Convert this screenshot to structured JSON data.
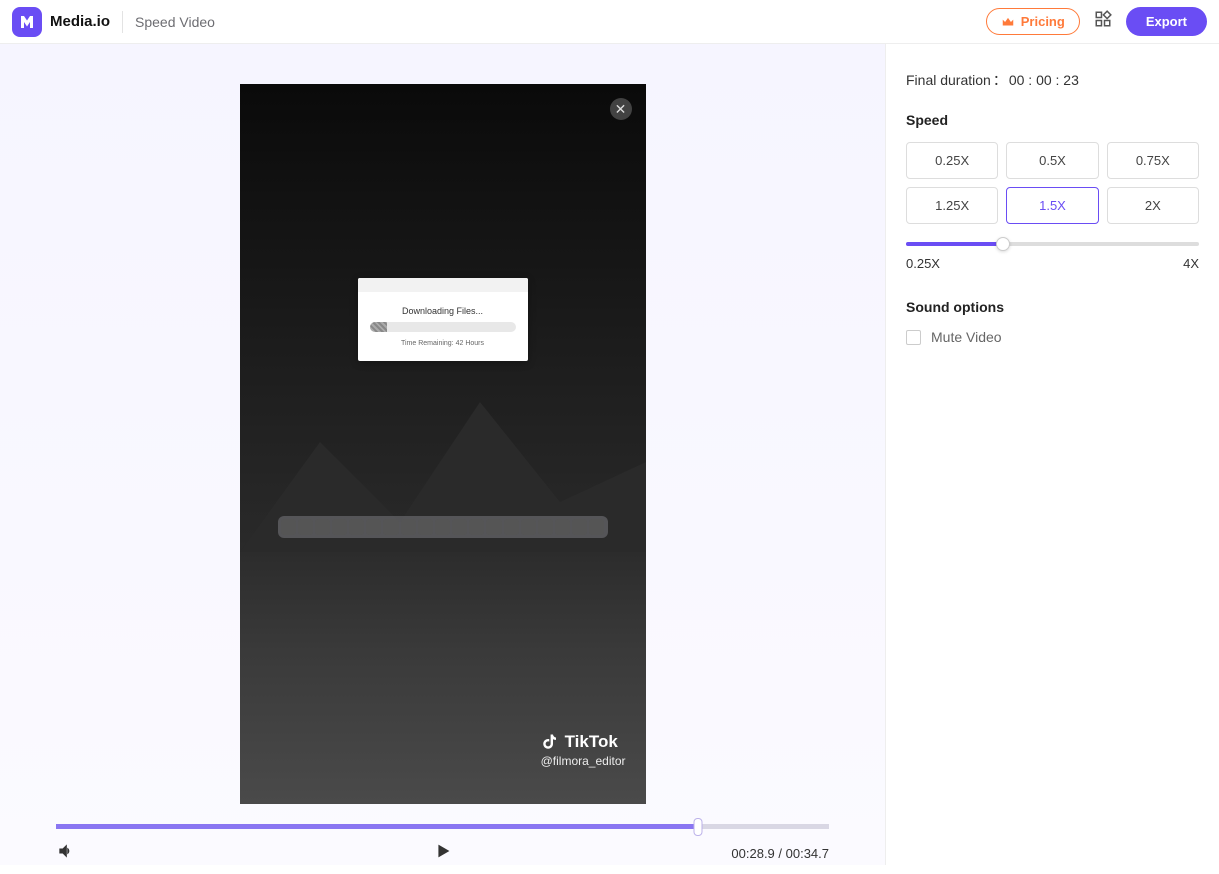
{
  "header": {
    "brand": "Media.io",
    "tool": "Speed Video",
    "pricing_label": "Pricing",
    "export_label": "Export"
  },
  "preview": {
    "dialog_title": "Downloading Files...",
    "dialog_time_label": "Time Remaining:",
    "dialog_time_value": "42 Hours",
    "tiktok_brand": "TikTok",
    "tiktok_handle": "@filmora_editor"
  },
  "playback": {
    "current_time": "00:28.9",
    "total_time": "00:34.7",
    "progress_pct": 83
  },
  "side": {
    "final_duration_label": "Final duration",
    "final_duration_value": "00 : 00 : 23",
    "speed_title": "Speed",
    "speed_options": [
      "0.25X",
      "0.5X",
      "0.75X",
      "1.25X",
      "1.5X",
      "2X"
    ],
    "speed_selected": "1.5X",
    "slider_min_label": "0.25X",
    "slider_max_label": "4X",
    "slider_pct": 33,
    "sound_title": "Sound options",
    "mute_label": "Mute Video",
    "mute_checked": false
  }
}
